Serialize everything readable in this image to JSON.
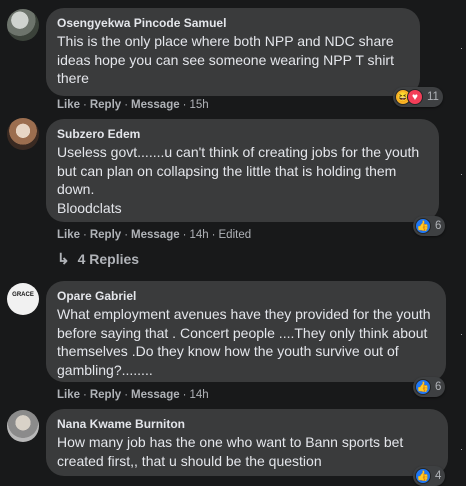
{
  "comments": [
    {
      "author": "Osengyekwa Pincode Samuel",
      "text": "This is the only place where both NPP and NDC share ideas hope you can see someone wearing NPP T shirt there",
      "like": "Like",
      "reply": "Reply",
      "message": "Message",
      "time": "15h",
      "reactions": [
        "haha",
        "love"
      ],
      "reaction_count": "11"
    },
    {
      "author": "Subzero Edem",
      "text": "Useless govt.......u can't think of creating jobs for the youth but can plan on collapsing the little that is holding them down.\nBloodclats",
      "like": "Like",
      "reply": "Reply",
      "message": "Message",
      "time": "14h",
      "edited": "Edited",
      "reactions": [
        "like"
      ],
      "reaction_count": "6",
      "replies_label": "4 Replies"
    },
    {
      "author": "Opare Gabriel",
      "avatar_text": "GRACE",
      "text": "What employment avenues have they provided for the youth before saying that . Concert people ....They only think about themselves .Do they know how the youth survive out of gambling?........",
      "like": "Like",
      "reply": "Reply",
      "message": "Message",
      "time": "14h",
      "reactions": [
        "like"
      ],
      "reaction_count": "6"
    },
    {
      "author": "Nana Kwame Burniton",
      "text": "How many job has the one who want to Bann sports bet created first,, that u should be the question",
      "reactions": [
        "like"
      ],
      "reaction_count": "4"
    }
  ],
  "icons": {
    "like": "thumbs-up-icon",
    "haha": "haha-emoji-icon",
    "love": "heart-icon",
    "replies": "reply-arrow-icon",
    "more": "more-options-icon"
  },
  "colors": {
    "background": "#18191a",
    "bubble": "#3a3b3c",
    "like_blue": "#2078f4",
    "love_red": "#f33e58",
    "haha_yellow": "#f7b125",
    "secondary_text": "#b0b3b8"
  }
}
